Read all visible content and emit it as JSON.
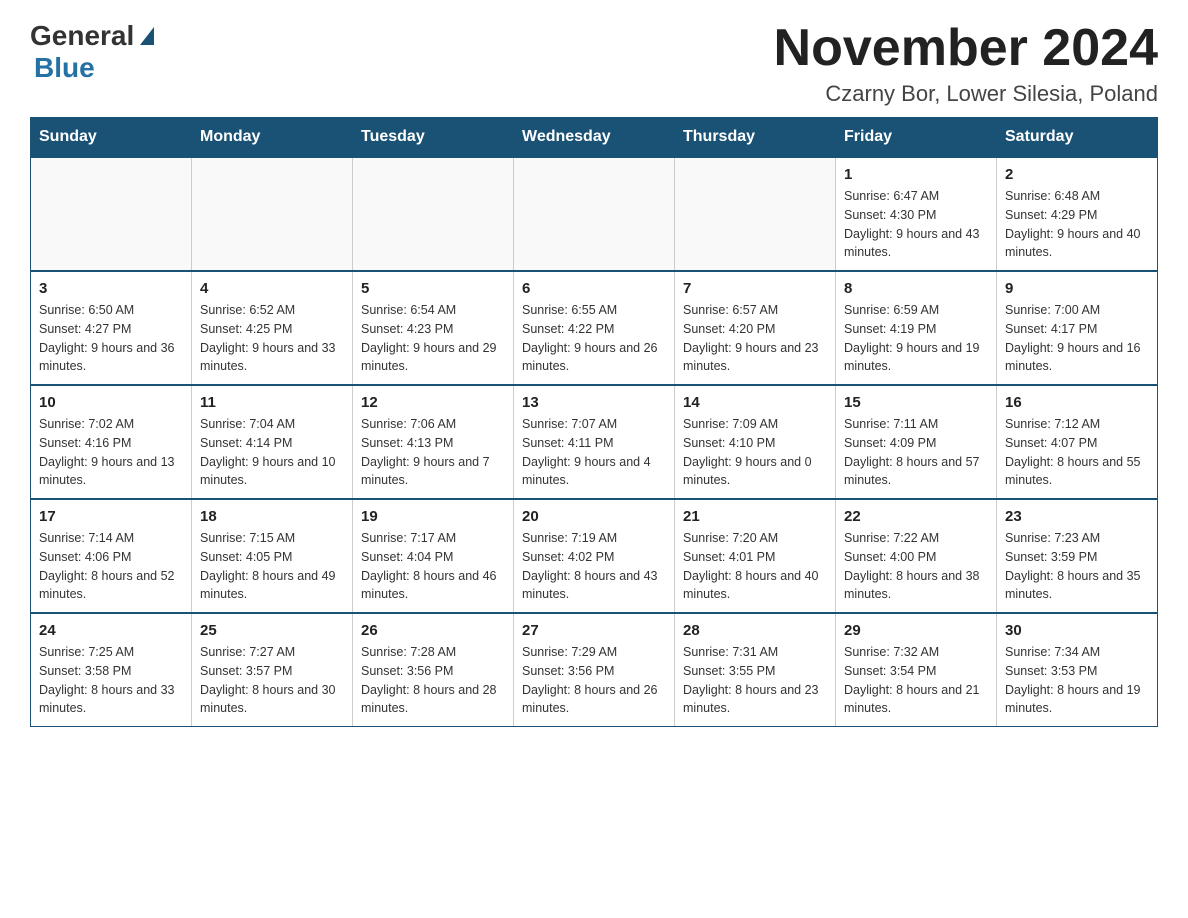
{
  "header": {
    "logo_general": "General",
    "logo_blue": "Blue",
    "month_title": "November 2024",
    "location": "Czarny Bor, Lower Silesia, Poland"
  },
  "days_of_week": [
    "Sunday",
    "Monday",
    "Tuesday",
    "Wednesday",
    "Thursday",
    "Friday",
    "Saturday"
  ],
  "weeks": [
    [
      {
        "day": "",
        "info": ""
      },
      {
        "day": "",
        "info": ""
      },
      {
        "day": "",
        "info": ""
      },
      {
        "day": "",
        "info": ""
      },
      {
        "day": "",
        "info": ""
      },
      {
        "day": "1",
        "info": "Sunrise: 6:47 AM\nSunset: 4:30 PM\nDaylight: 9 hours and 43 minutes."
      },
      {
        "day": "2",
        "info": "Sunrise: 6:48 AM\nSunset: 4:29 PM\nDaylight: 9 hours and 40 minutes."
      }
    ],
    [
      {
        "day": "3",
        "info": "Sunrise: 6:50 AM\nSunset: 4:27 PM\nDaylight: 9 hours and 36 minutes."
      },
      {
        "day": "4",
        "info": "Sunrise: 6:52 AM\nSunset: 4:25 PM\nDaylight: 9 hours and 33 minutes."
      },
      {
        "day": "5",
        "info": "Sunrise: 6:54 AM\nSunset: 4:23 PM\nDaylight: 9 hours and 29 minutes."
      },
      {
        "day": "6",
        "info": "Sunrise: 6:55 AM\nSunset: 4:22 PM\nDaylight: 9 hours and 26 minutes."
      },
      {
        "day": "7",
        "info": "Sunrise: 6:57 AM\nSunset: 4:20 PM\nDaylight: 9 hours and 23 minutes."
      },
      {
        "day": "8",
        "info": "Sunrise: 6:59 AM\nSunset: 4:19 PM\nDaylight: 9 hours and 19 minutes."
      },
      {
        "day": "9",
        "info": "Sunrise: 7:00 AM\nSunset: 4:17 PM\nDaylight: 9 hours and 16 minutes."
      }
    ],
    [
      {
        "day": "10",
        "info": "Sunrise: 7:02 AM\nSunset: 4:16 PM\nDaylight: 9 hours and 13 minutes."
      },
      {
        "day": "11",
        "info": "Sunrise: 7:04 AM\nSunset: 4:14 PM\nDaylight: 9 hours and 10 minutes."
      },
      {
        "day": "12",
        "info": "Sunrise: 7:06 AM\nSunset: 4:13 PM\nDaylight: 9 hours and 7 minutes."
      },
      {
        "day": "13",
        "info": "Sunrise: 7:07 AM\nSunset: 4:11 PM\nDaylight: 9 hours and 4 minutes."
      },
      {
        "day": "14",
        "info": "Sunrise: 7:09 AM\nSunset: 4:10 PM\nDaylight: 9 hours and 0 minutes."
      },
      {
        "day": "15",
        "info": "Sunrise: 7:11 AM\nSunset: 4:09 PM\nDaylight: 8 hours and 57 minutes."
      },
      {
        "day": "16",
        "info": "Sunrise: 7:12 AM\nSunset: 4:07 PM\nDaylight: 8 hours and 55 minutes."
      }
    ],
    [
      {
        "day": "17",
        "info": "Sunrise: 7:14 AM\nSunset: 4:06 PM\nDaylight: 8 hours and 52 minutes."
      },
      {
        "day": "18",
        "info": "Sunrise: 7:15 AM\nSunset: 4:05 PM\nDaylight: 8 hours and 49 minutes."
      },
      {
        "day": "19",
        "info": "Sunrise: 7:17 AM\nSunset: 4:04 PM\nDaylight: 8 hours and 46 minutes."
      },
      {
        "day": "20",
        "info": "Sunrise: 7:19 AM\nSunset: 4:02 PM\nDaylight: 8 hours and 43 minutes."
      },
      {
        "day": "21",
        "info": "Sunrise: 7:20 AM\nSunset: 4:01 PM\nDaylight: 8 hours and 40 minutes."
      },
      {
        "day": "22",
        "info": "Sunrise: 7:22 AM\nSunset: 4:00 PM\nDaylight: 8 hours and 38 minutes."
      },
      {
        "day": "23",
        "info": "Sunrise: 7:23 AM\nSunset: 3:59 PM\nDaylight: 8 hours and 35 minutes."
      }
    ],
    [
      {
        "day": "24",
        "info": "Sunrise: 7:25 AM\nSunset: 3:58 PM\nDaylight: 8 hours and 33 minutes."
      },
      {
        "day": "25",
        "info": "Sunrise: 7:27 AM\nSunset: 3:57 PM\nDaylight: 8 hours and 30 minutes."
      },
      {
        "day": "26",
        "info": "Sunrise: 7:28 AM\nSunset: 3:56 PM\nDaylight: 8 hours and 28 minutes."
      },
      {
        "day": "27",
        "info": "Sunrise: 7:29 AM\nSunset: 3:56 PM\nDaylight: 8 hours and 26 minutes."
      },
      {
        "day": "28",
        "info": "Sunrise: 7:31 AM\nSunset: 3:55 PM\nDaylight: 8 hours and 23 minutes."
      },
      {
        "day": "29",
        "info": "Sunrise: 7:32 AM\nSunset: 3:54 PM\nDaylight: 8 hours and 21 minutes."
      },
      {
        "day": "30",
        "info": "Sunrise: 7:34 AM\nSunset: 3:53 PM\nDaylight: 8 hours and 19 minutes."
      }
    ]
  ]
}
